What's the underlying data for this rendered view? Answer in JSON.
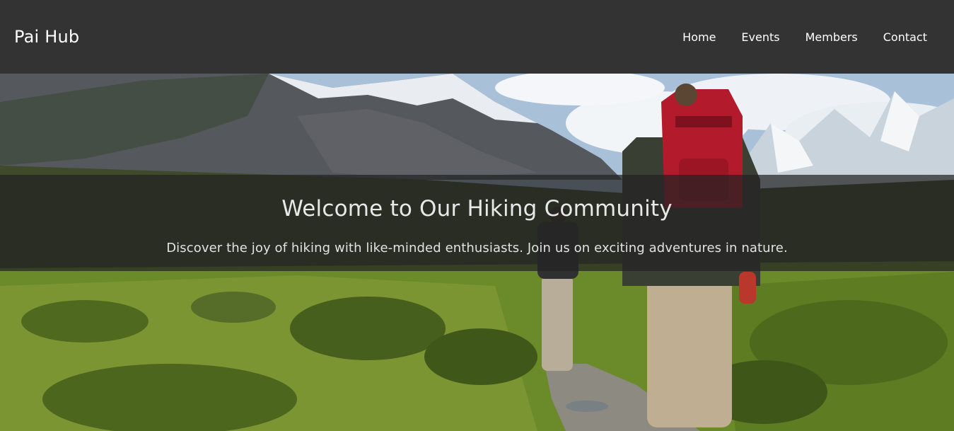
{
  "navbar": {
    "brand": "Pai Hub",
    "links": [
      {
        "label": "Home"
      },
      {
        "label": "Events"
      },
      {
        "label": "Members"
      },
      {
        "label": "Contact"
      }
    ]
  },
  "hero": {
    "title": "Welcome to Our Hiking Community",
    "subtitle": "Discover the joy of hiking with like-minded enthusiasts. Join us on exciting adventures in nature.",
    "image_description": "hikers-on-mountain-trail",
    "colors": {
      "overlay": "#222222",
      "navbar": "#333333",
      "backpack": "#b31a2c",
      "grass": "#6f8f26"
    }
  }
}
